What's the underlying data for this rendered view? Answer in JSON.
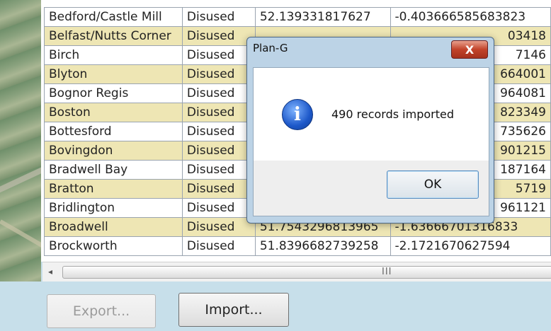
{
  "table": {
    "rows": [
      {
        "name": "Bedford/Castle Mill",
        "status": "Disused",
        "lat": "52.139331817627",
        "lon": "-0.403666585683823"
      },
      {
        "name": "Belfast/Nutts Corner",
        "status": "Disused",
        "lat": "",
        "lon": "03418"
      },
      {
        "name": "Birch",
        "status": "Disused",
        "lat": "",
        "lon": "7146"
      },
      {
        "name": "Blyton",
        "status": "Disused",
        "lat": "",
        "lon": "664001"
      },
      {
        "name": "Bognor Regis",
        "status": "Disused",
        "lat": "",
        "lon": "964081"
      },
      {
        "name": "Boston",
        "status": "Disused",
        "lat": "",
        "lon": "823349"
      },
      {
        "name": "Bottesford",
        "status": "Disused",
        "lat": "",
        "lon": "735626"
      },
      {
        "name": "Bovingdon",
        "status": "Disused",
        "lat": "",
        "lon": "901215"
      },
      {
        "name": "Bradwell Bay",
        "status": "Disused",
        "lat": "",
        "lon": "187164"
      },
      {
        "name": "Bratton",
        "status": "Disused",
        "lat": "",
        "lon": "5719"
      },
      {
        "name": "Bridlington",
        "status": "Disused",
        "lat": "",
        "lon": "961121"
      },
      {
        "name": "Broadwell",
        "status": "Disused",
        "lat": "51.7543296813965",
        "lon": "-1.63666701316833"
      },
      {
        "name": "Brockworth",
        "status": "Disused",
        "lat": "51.8396682739258",
        "lon": "-2.1721670627594"
      }
    ]
  },
  "scrollbar": {
    "left_arrow": "◂",
    "grip": "III"
  },
  "buttons": {
    "export_label": "Export...",
    "import_label": "Import..."
  },
  "dialog": {
    "title": "Plan-G",
    "close_glyph": "X",
    "message": "490 records imported",
    "ok_label": "OK",
    "icon": "info-icon",
    "icon_glyph": "i"
  },
  "colors": {
    "row_alt": "#eee6b4",
    "background": "#c7dfea",
    "dialog_frame": "#bcd3e6"
  }
}
